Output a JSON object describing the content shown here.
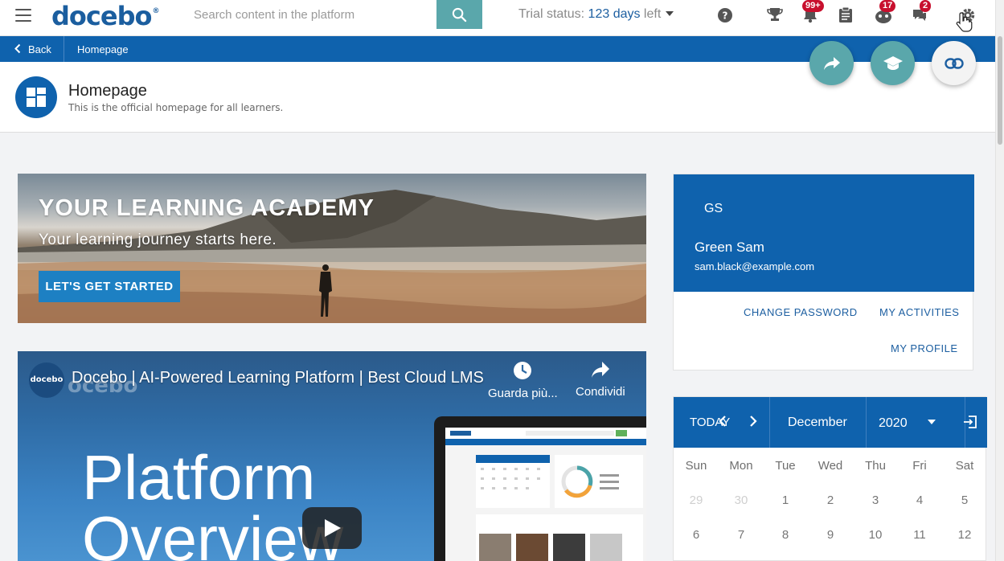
{
  "topbar": {
    "logo": "docebo",
    "logo_mark": "®",
    "search_placeholder": "Search content in the platform",
    "trial_prefix": "Trial status: ",
    "trial_days": "123 days",
    "trial_suffix": " left",
    "badges": {
      "notifications": "99+",
      "gamification": "17",
      "messages": "2"
    }
  },
  "navbar": {
    "back_label": "Back",
    "breadcrumb": "Homepage"
  },
  "page": {
    "title": "Homepage",
    "subtitle": "This is the official homepage for all learners."
  },
  "banner": {
    "title": "YOUR LEARNING ACADEMY",
    "subtitle": "Your learning journey starts here.",
    "button": "LET'S GET STARTED"
  },
  "video": {
    "channel_initial": "docebo",
    "title": "Docebo | AI-Powered Learning Platform | Best Cloud LMS",
    "ghost_text": "ocebo",
    "watch_later": "Guarda più...",
    "share": "Condividi",
    "big_line1": "Platform",
    "big_line2": "Overview"
  },
  "profile": {
    "initials": "GS",
    "name": "Green Sam",
    "email": "sam.black@example.com",
    "change_password": "CHANGE PASSWORD",
    "my_activities": "MY ACTIVITIES",
    "my_profile": "MY PROFILE"
  },
  "calendar": {
    "today": "TODAY",
    "month": "December",
    "year": "2020",
    "weekdays": [
      "Sun",
      "Mon",
      "Tue",
      "Wed",
      "Thu",
      "Fri",
      "Sat"
    ],
    "week1": [
      "29",
      "30",
      "1",
      "2",
      "3",
      "4",
      "5"
    ],
    "week2": [
      "6",
      "7",
      "8",
      "9",
      "10",
      "11",
      "12"
    ]
  },
  "colors": {
    "brand_blue": "#0f62ad",
    "teal": "#5aa7ab",
    "badge_red": "#c8102e",
    "link_blue": "#1d5fa1"
  }
}
